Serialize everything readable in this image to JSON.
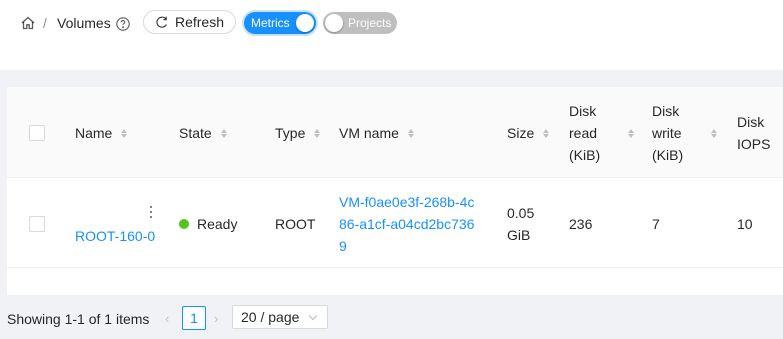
{
  "header": {
    "breadcrumb_sep": "/",
    "title": "Volumes",
    "refresh_label": "Refresh",
    "metrics_label": "Metrics",
    "metrics_on": true,
    "projects_label": "Projects",
    "projects_on": false
  },
  "table": {
    "columns": [
      "Name",
      "State",
      "Type",
      "VM name",
      "Size",
      "Disk read (KiB)",
      "Disk write (KiB)",
      "Disk IOPS"
    ],
    "rows": [
      {
        "name": "ROOT-160-0",
        "state": "Ready",
        "type": "ROOT",
        "vm_name": "VM-f0ae0e3f-268b-4c86-a1cf-a04cd2bc7369",
        "size": "0.05 GiB",
        "disk_read": "236",
        "disk_write": "7",
        "disk_iops": "10"
      }
    ]
  },
  "pagination": {
    "summary": "Showing 1-1 of 1 items",
    "current_page": "1",
    "page_size": "20 / page"
  },
  "colors": {
    "primary": "#1890ff",
    "ready": "#52c41a"
  },
  "icons": [
    "home-icon",
    "help-icon",
    "refresh-icon",
    "sort-icon",
    "more-icon",
    "chevron-left-icon",
    "chevron-right-icon",
    "chevron-down-icon"
  ]
}
